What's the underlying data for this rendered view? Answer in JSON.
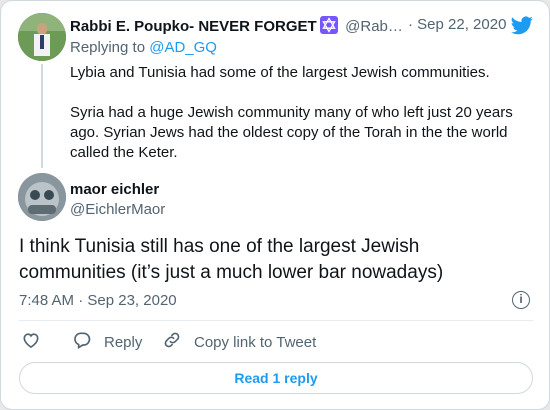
{
  "first_tweet": {
    "display_name": "Rabbi E. Poupko- NEVER FORGET",
    "handle": "@Rab…",
    "separator": "·",
    "date": "Sep 22, 2020",
    "replying_to_prefix": "Replying to",
    "replying_to_handle": "@AD_GQ",
    "paragraphs": [
      "Lybia and Tunisia had some of the largest Jewish communities.",
      "Syria had a huge Jewish community many of who left just 20 years ago. Syrian Jews had the oldest copy of the Torah in the the world called the Keter."
    ]
  },
  "main_tweet": {
    "display_name": "maor eichler",
    "handle": "@EichlerMaor",
    "text": "I think Tunisia still has one of the largest Jewish communities (it’s just a much lower bar nowadays)",
    "time": "7:48 AM",
    "separator": "·",
    "date": "Sep 23, 2020",
    "info_label": "i"
  },
  "actions": {
    "reply_label": "Reply",
    "copy_link_label": "Copy link to Tweet"
  },
  "read_replies_label": "Read 1 reply",
  "icons": {
    "star_of_david": "star-of-david-icon",
    "twitter_bird": "twitter-bird-icon",
    "like": "heart-icon",
    "reply": "speech-bubble-icon",
    "copy_link": "link-icon",
    "info": "info-icon"
  },
  "colors": {
    "accent": "#1d9bf0",
    "muted_text": "#536471",
    "star_badge": "#7856ff"
  }
}
